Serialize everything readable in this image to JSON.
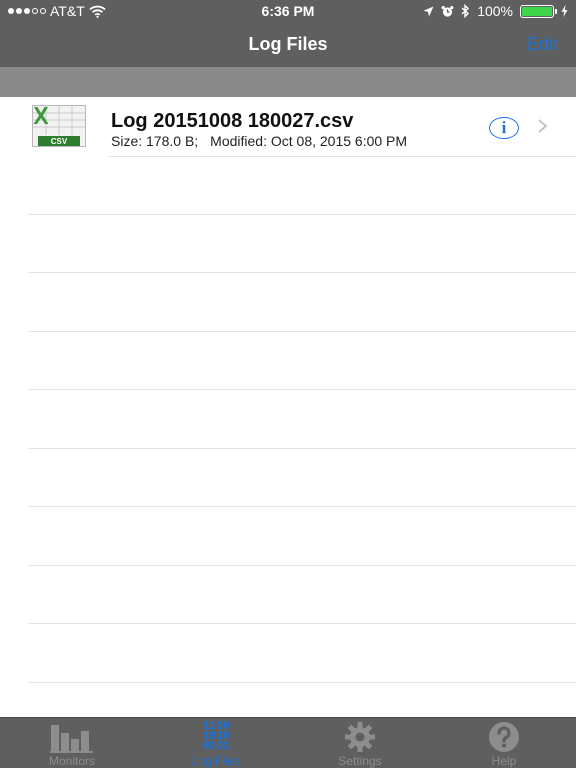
{
  "status_bar": {
    "carrier": "AT&T",
    "time": "6:36 PM",
    "battery": "100%",
    "signal_bars_filled": 3,
    "signal_bars_total": 5,
    "battery_level": 1.0
  },
  "nav": {
    "title": "Log Files",
    "edit_label": "Edit"
  },
  "files": [
    {
      "name": "Log 20151008 180027.csv",
      "size": "Size: 178.0 B;",
      "modified": "Modified: Oct 08, 2015 6:00 PM",
      "icon": "csv-file-icon",
      "icon_badge": "CSV",
      "info_glyph": "i"
    }
  ],
  "tab_bar": {
    "tabs": [
      {
        "label": "Monitors",
        "icon": "bar-chart-icon",
        "active": false
      },
      {
        "label": "Log Files",
        "icon": "binary-icon",
        "active": true,
        "glyph_lines": [
          "1100",
          "1010",
          "0101"
        ]
      },
      {
        "label": "Settings",
        "icon": "gear-icon",
        "active": false
      },
      {
        "label": "Help",
        "icon": "question-icon",
        "active": false
      }
    ]
  },
  "colors": {
    "accent": "#1a73d9",
    "bar_background": "#5f5f5f",
    "inactive_tab": "#8d8d8d",
    "battery_fill": "#3fd44a",
    "excel_green": "#2f7d2f"
  }
}
